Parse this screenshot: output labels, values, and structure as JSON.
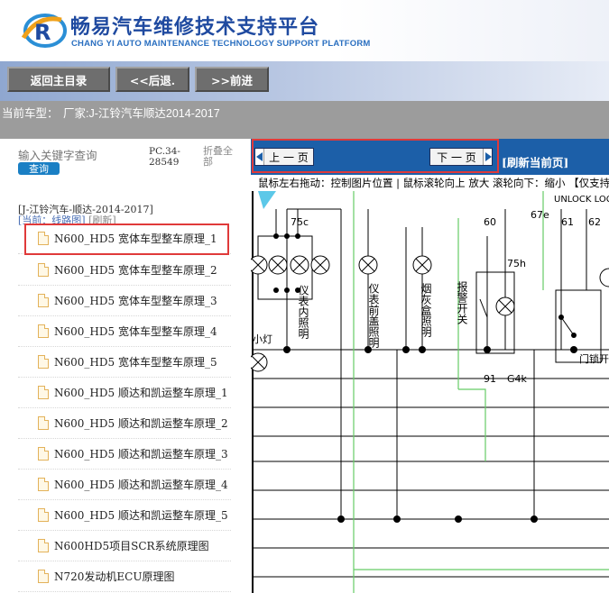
{
  "header": {
    "title_cn": "畅易汽车维修技术支持平台",
    "title_en": "CHANG YI AUTO MAINTENANCE TECHNOLOGY SUPPORT PLATFORM"
  },
  "nav": {
    "home": "返回主目录",
    "back": "<<后退.",
    "forward": ">>前进"
  },
  "vehicle": {
    "label": "当前车型：",
    "value": "厂家:J-江铃汽车顺达2014-2017"
  },
  "sidebar": {
    "search_placeholder": "输入关键字查询",
    "search_button": "查询",
    "pc_code": "PC.34-28549",
    "collapse_all": "折叠全部",
    "tree_root": "[J-江铃汽车-顺达-2014-2017]",
    "current_prefix": "[当前：线路图]",
    "refresh": "[刷新]",
    "items": [
      {
        "label": "N600_HD5 宽体车型整车原理_1"
      },
      {
        "label": "N600_HD5 宽体车型整车原理_2"
      },
      {
        "label": "N600_HD5 宽体车型整车原理_3"
      },
      {
        "label": "N600_HD5 宽体车型整车原理_4"
      },
      {
        "label": "N600_HD5 宽体车型整车原理_5"
      },
      {
        "label": "N600_HD5 顺达和凯运整车原理_1"
      },
      {
        "label": "N600_HD5 顺达和凯运整车原理_2"
      },
      {
        "label": "N600_HD5 顺达和凯运整车原理_3"
      },
      {
        "label": "N600_HD5 顺达和凯运整车原理_4"
      },
      {
        "label": "N600_HD5 顺达和凯运整车原理_5"
      },
      {
        "label": "N600HD5项目SCR系统原理图"
      },
      {
        "label": "N720发动机ECU原理图"
      }
    ]
  },
  "viewer": {
    "prev": "上 一 页",
    "next": "下 一 页",
    "refresh_current": "[刷新当前页]",
    "hint": "鼠标左右拖动：控制图片位置 | 鼠标滚轮向上 放大  滚轮向下：缩小 【仅支持IE浏览器】"
  },
  "diagram": {
    "labels": {
      "t75c": "75c",
      "t60": "60",
      "t67e": "67e",
      "t61": "61",
      "t62": "62",
      "t75h": "75h",
      "t91": "91",
      "tG4k": "G4k",
      "unlock_lock": "UNLOCK LOCK",
      "small_light": "小灯",
      "door_lock": "门锁开",
      "col1": "仪表内照明",
      "col2": "仪表前盖照明",
      "col3": "烟灰盒照明",
      "col4": "报警开关"
    }
  }
}
